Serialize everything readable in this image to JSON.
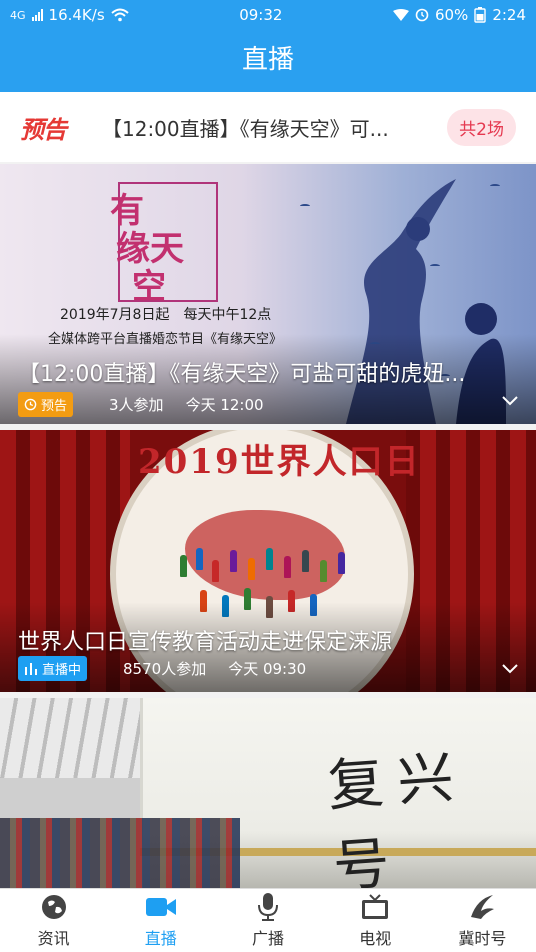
{
  "status": {
    "network_speed": "16.4K/s",
    "network_type": "4G",
    "time": "09:32",
    "battery": "60%",
    "right_extra": "2:24"
  },
  "header": {
    "title": "直播"
  },
  "preview": {
    "tag": "预告",
    "title": "【12:00直播】《有缘天空》可...",
    "count": "共2场"
  },
  "cards": [
    {
      "title": "【12:00直播】《有缘天空》可盐可甜的虎妞...",
      "status_label": "预告",
      "status_icon": "clock-icon",
      "participants": "3人参加",
      "time": "今天 12:00",
      "art": {
        "logo_line1": "有",
        "logo_line2": "缘天",
        "logo_line3": "空",
        "line1": "2019年7月8日起　每天中午12点",
        "line2": "全媒体跨平台直播婚恋节目《有缘天空》"
      },
      "colors": {
        "badge": "#f39c12"
      }
    },
    {
      "title": "世界人口日宣传教育活动走进保定涞源",
      "status_label": "直播中",
      "status_icon": "live-bars-icon",
      "participants": "8570人参加",
      "time": "今天 09:30",
      "art": {
        "banner": "2019世界人口日"
      },
      "colors": {
        "badge": "#1e9ff2"
      }
    },
    {
      "art": {
        "brand": "复兴号"
      }
    }
  ],
  "nav": {
    "items": [
      {
        "label": "资讯",
        "icon": "globe-icon",
        "active": false
      },
      {
        "label": "直播",
        "icon": "video-camera-icon",
        "active": true
      },
      {
        "label": "广播",
        "icon": "microphone-icon",
        "active": false
      },
      {
        "label": "电视",
        "icon": "tv-icon",
        "active": false
      },
      {
        "label": "冀时号",
        "icon": "swoosh-icon",
        "active": false
      }
    ]
  },
  "colors": {
    "primary": "#2aa0f0",
    "accent_active": "#1e9ff2",
    "preview_red": "#e53935"
  }
}
